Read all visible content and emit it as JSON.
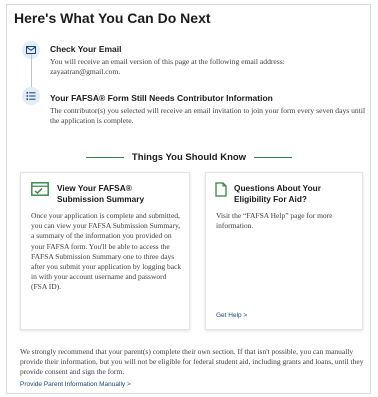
{
  "page": {
    "title": "Here's What You Can Do Next"
  },
  "steps": [
    {
      "icon": "email-icon",
      "title": "Check Your Email",
      "body": "You will receive an email version of this page at the following email address:",
      "email": "zayaatran@gmail.com."
    },
    {
      "icon": "checklist-icon",
      "title": "Your FAFSA® Form Still Needs Contributor Information",
      "body": "The contributor(s) you selected will receive an email invitation to join your form every seven days until the application is complete."
    }
  ],
  "section": {
    "title": "Things You Should Know"
  },
  "cards": [
    {
      "icon": "fafsa-summary-icon",
      "title": "View Your FAFSA® Submission Summary",
      "body": "Once your application is complete and submitted, you can view your FAFSA Submission Summary, a summary of the information you provided on your FAFSA form. You'll be able to access the FAFSA Submission Summary one to three days after you submit your application by logging back in with your account username and password (FSA ID)."
    },
    {
      "icon": "document-icon",
      "title": "Questions About Your Eligibility For Aid?",
      "body": "Visit the “FAFSA Help” page for more information.",
      "link": "Get Help  >"
    }
  ],
  "bottom": {
    "text": "We strongly recommend that your parent(s) complete their own section. If that isn't possible, you can manually provide their information, but you will not be eligible for federal student aid, including grants and loans, until they provide consent and sign the form.",
    "link": "Provide Parent Information Manually  >"
  },
  "colors": {
    "accent_blue": "#1a4480",
    "accent_green": "#2e8540",
    "icon_bg": "#e4ecf7"
  }
}
